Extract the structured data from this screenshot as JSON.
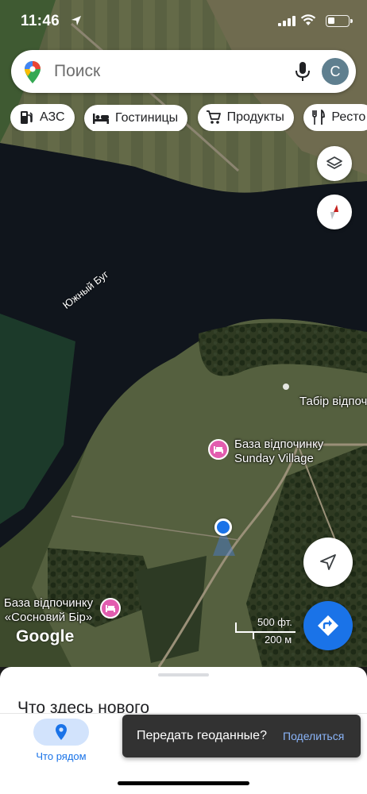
{
  "status_bar": {
    "time": "11:46"
  },
  "search": {
    "placeholder": "Поиск",
    "avatar_letter": "C"
  },
  "chips": [
    {
      "icon": "gas-station-icon",
      "label": "АЗС"
    },
    {
      "icon": "bed-icon",
      "label": "Гостиницы"
    },
    {
      "icon": "cart-icon",
      "label": "Продукты"
    },
    {
      "icon": "fork-knife-icon",
      "label": "Ресто"
    }
  ],
  "map": {
    "river_label": "Южный Буг",
    "places": [
      {
        "name_line1": "База відпочинку",
        "name_line2": "Sunday Village"
      },
      {
        "name_line1": "База відпочинку",
        "name_line2": "«Сосновий Бір»"
      },
      {
        "name_line1": "Табір відпочинку"
      }
    ],
    "watermark": "Google",
    "scale": {
      "imperial": "500 фт.",
      "metric": "200 м"
    }
  },
  "sheet": {
    "heading": "Что здесь нового"
  },
  "tabs": [
    {
      "label": "Что рядом",
      "active": true
    }
  ],
  "snackbar": {
    "message": "Передать геоданные?",
    "action": "Поделиться"
  },
  "colors": {
    "accent": "#1a73e8",
    "poi": "#e25daf",
    "snackbar": "#323232"
  }
}
